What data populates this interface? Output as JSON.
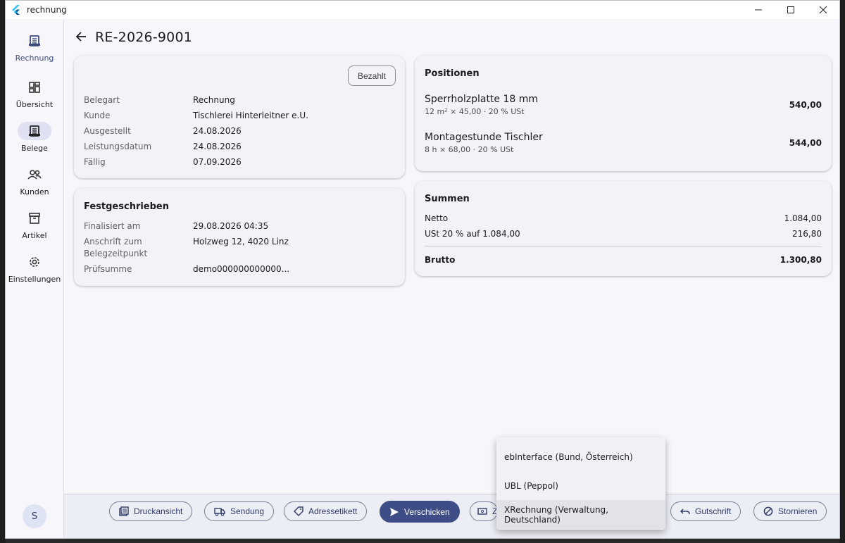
{
  "window": {
    "title": "rechnung"
  },
  "rail": {
    "top": {
      "label": "Rechnung",
      "icon": "receipt-icon"
    },
    "items": [
      {
        "label": "Übersicht",
        "icon": "dashboard-icon"
      },
      {
        "label": "Belege",
        "icon": "receipt-icon",
        "selected": true
      },
      {
        "label": "Kunden",
        "icon": "people-icon"
      },
      {
        "label": "Artikel",
        "icon": "archive-icon"
      },
      {
        "label": "Einstellungen",
        "icon": "gear-icon"
      }
    ],
    "avatar": "S"
  },
  "header": {
    "title": "RE-2026-9001"
  },
  "details": {
    "paid_label": "Bezahlt",
    "rows": [
      {
        "k": "Belegart",
        "v": "Rechnung"
      },
      {
        "k": "Kunde",
        "v": "Tischlerei Hinterleitner e.U."
      },
      {
        "k": "Ausgestellt",
        "v": "24.08.2026"
      },
      {
        "k": "Leistungsdatum",
        "v": "24.08.2026"
      },
      {
        "k": "Fällig",
        "v": "07.09.2026"
      }
    ]
  },
  "fixed": {
    "title": "Festgeschrieben",
    "rows": [
      {
        "k": "Finalisiert am",
        "v": "29.08.2026 04:35"
      },
      {
        "k1": "Anschrift zum",
        "k2": "Belegzeitpunkt",
        "v": "Holzweg 12, 4020 Linz"
      },
      {
        "k": "Prüfsumme",
        "v": "demo000000000000..."
      }
    ]
  },
  "positions": {
    "title": "Positionen",
    "items": [
      {
        "name": "Sperrholzplatte 18 mm",
        "sub": "12 m² × 45,00 · 20 % USt",
        "amount": "540,00"
      },
      {
        "name": "Montagestunde Tischler",
        "sub": "8 h × 68,00 · 20 % USt",
        "amount": "544,00"
      }
    ]
  },
  "sums": {
    "title": "Summen",
    "netto_label": "Netto",
    "netto": "1.084,00",
    "ust_label": "USt 20 % auf 1.084,00",
    "ust": "216,80",
    "brutto_label": "Brutto",
    "brutto": "1.300,80"
  },
  "actions": {
    "print": "Druckansicht",
    "ship": "Sendung",
    "label": "Adressetikett",
    "send": "Verschicken",
    "hidden_partial": "Z",
    "credit": "Gutschrift",
    "cancel": "Stornieren"
  },
  "menu": {
    "items": [
      "ebInterface (Bund, Österreich)",
      "UBL (Peppol)",
      "XRechnung (Verwaltung, Deutschland)"
    ]
  },
  "colors": {
    "primary": "#3e4d86",
    "rail_selected": "#dfe1f2"
  }
}
